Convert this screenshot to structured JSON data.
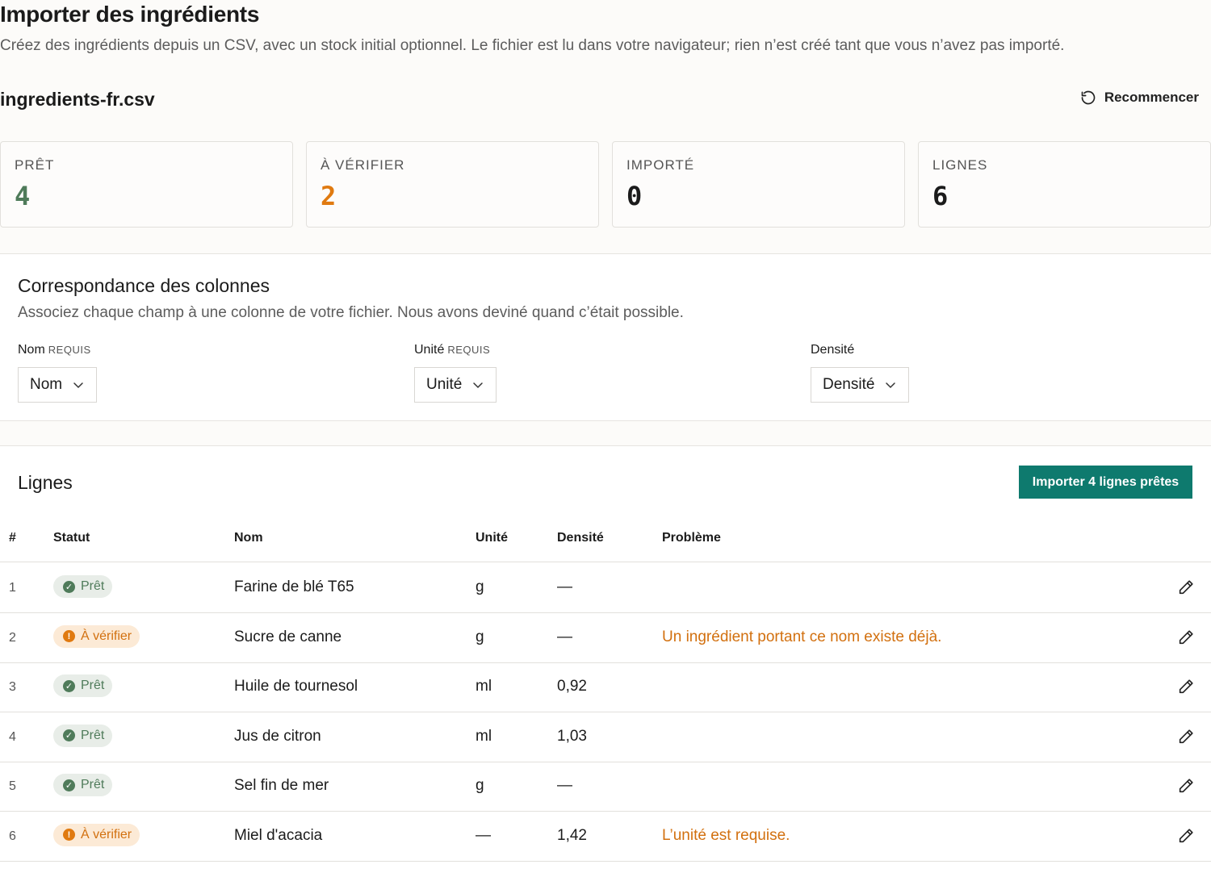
{
  "header": {
    "title": "Importer des ingrédients",
    "subtitle": "Créez des ingrédients depuis un CSV, avec un stock initial optionnel. Le fichier est lu dans votre navigateur; rien n’est créé tant que vous n’avez pas importé."
  },
  "file": {
    "name": "ingredients-fr.csv",
    "restart_label": "Recommencer"
  },
  "stats": [
    {
      "label": "PRÊT",
      "value": "4",
      "color": "#4f7b5a"
    },
    {
      "label": "À VÉRIFIER",
      "value": "2",
      "color": "#e07a10"
    },
    {
      "label": "IMPORTÉ",
      "value": "0",
      "color": "#1b1b1b"
    },
    {
      "label": "LIGNES",
      "value": "6",
      "color": "#1b1b1b"
    }
  ],
  "mapping": {
    "title": "Correspondance des colonnes",
    "description": "Associez chaque champ à une colonne de votre fichier. Nous avons deviné quand c’était possible.",
    "fields": [
      {
        "label": "Nom",
        "required_tag": "REQUIS",
        "selected": "Nom"
      },
      {
        "label": "Unité",
        "required_tag": "REQUIS",
        "selected": "Unité"
      },
      {
        "label": "Densité",
        "required_tag": "",
        "selected": "Densité"
      }
    ]
  },
  "rows_section": {
    "title": "Lignes",
    "import_button": "Importer 4 lignes prêtes",
    "columns": [
      "#",
      "Statut",
      "Nom",
      "Unité",
      "Densité",
      "Problème"
    ],
    "rows": [
      {
        "index": "1",
        "status": "Prêt",
        "status_type": "ready",
        "name": "Farine de blé T65",
        "unit": "g",
        "density": "—",
        "problem": ""
      },
      {
        "index": "2",
        "status": "À vérifier",
        "status_type": "review",
        "name": "Sucre de canne",
        "unit": "g",
        "density": "—",
        "problem": "Un ingrédient portant ce nom existe déjà."
      },
      {
        "index": "3",
        "status": "Prêt",
        "status_type": "ready",
        "name": "Huile de tournesol",
        "unit": "ml",
        "density": "0,92",
        "problem": ""
      },
      {
        "index": "4",
        "status": "Prêt",
        "status_type": "ready",
        "name": "Jus de citron",
        "unit": "ml",
        "density": "1,03",
        "problem": ""
      },
      {
        "index": "5",
        "status": "Prêt",
        "status_type": "ready",
        "name": "Sel fin de mer",
        "unit": "g",
        "density": "—",
        "problem": ""
      },
      {
        "index": "6",
        "status": "À vérifier",
        "status_type": "review",
        "name": "Miel d'acacia",
        "unit": "—",
        "density": "1,42",
        "problem": "L’unité est requise."
      }
    ]
  },
  "icons": {
    "restart": "restart-icon",
    "chevron": "chevron-down-icon",
    "check": "check-circle-icon",
    "warning": "warning-circle-icon",
    "edit": "pencil-icon"
  },
  "colors": {
    "accent": "#0e7a6e",
    "ready": "#4f7b5a",
    "review": "#e07a10"
  }
}
